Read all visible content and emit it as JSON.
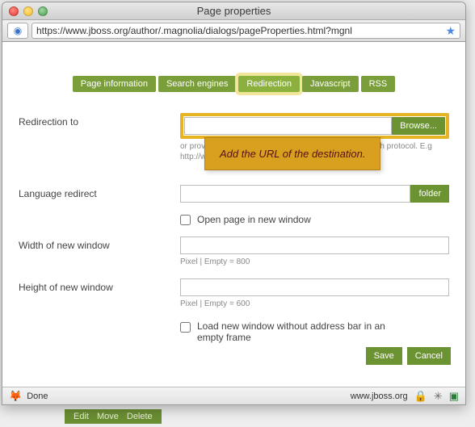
{
  "window": {
    "title": "Page properties"
  },
  "address": {
    "url": "https://www.jboss.org/author/.magnolia/dialogs/pageProperties.html?mgnl"
  },
  "tabs": [
    {
      "label": "Page information"
    },
    {
      "label": "Search engines"
    },
    {
      "label": "Redirection"
    },
    {
      "label": "Javascript"
    },
    {
      "label": "RSS"
    }
  ],
  "form": {
    "redirection_to_label": "Redirection to",
    "browse_button": "Browse...",
    "redirect_hint": "or provide external URL. Always write external URLs with protocol. E.g http://www.magnolia.info",
    "language_redirect_label": "Language redirect",
    "folder_button": "folder",
    "open_new_window_label": "Open page in new window",
    "width_label": "Width of new window",
    "width_hint": "Pixel | Empty = 800",
    "height_label": "Height of new window",
    "height_hint": "Pixel | Empty = 600",
    "no_addressbar_label": "Load new window without address bar in an empty frame"
  },
  "annotation": {
    "text": "Add the URL of the destination."
  },
  "actions": {
    "save": "Save",
    "cancel": "Cancel"
  },
  "status": {
    "done": "Done",
    "domain": "www.jboss.org"
  },
  "bg_toolbar": {
    "edit": "Edit",
    "move": "Move",
    "delete": "Delete"
  }
}
